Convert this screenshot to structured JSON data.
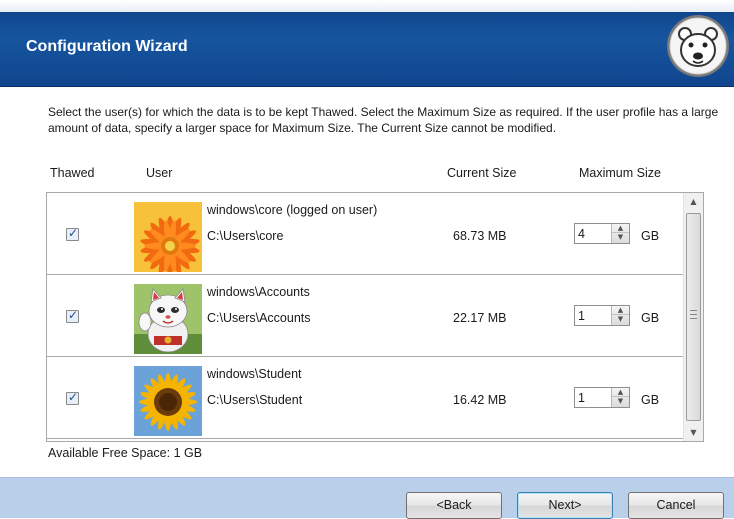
{
  "window": {
    "title": "Configuration Wizard"
  },
  "instruction": "Select the user(s) for which the data is to be kept Thawed. Select the Maximum Size as required. If the user profile has a large amount of data, specify a larger space for Maximum Size. The Current Size cannot be modified.",
  "columns": {
    "thawed": "Thawed",
    "user": "User",
    "current_size": "Current Size",
    "maximum_size": "Maximum Size"
  },
  "users": [
    {
      "name": "windows\\core (logged on user)",
      "path": "C:\\Users\\core",
      "current_size": "68.73 MB",
      "max_size": "4",
      "unit": "GB",
      "thawed": true,
      "image": "orange-gerbera-flower"
    },
    {
      "name": "windows\\Accounts",
      "path": "C:\\Users\\Accounts",
      "current_size": "22.17 MB",
      "max_size": "1",
      "unit": "GB",
      "thawed": true,
      "image": "lucky-cat-figurine"
    },
    {
      "name": "windows\\Student",
      "path": "C:\\Users\\Student",
      "current_size": "16.42 MB",
      "max_size": "1",
      "unit": "GB",
      "thawed": true,
      "image": "sunflower"
    }
  ],
  "free_space": {
    "label": "Available Free Space:",
    "value": "1 GB"
  },
  "buttons": {
    "back": "<Back",
    "next": "Next>",
    "cancel": "Cancel"
  },
  "icons": {
    "logo": "polar-bear-logo-icon",
    "spin_up": "arrow-up-icon",
    "spin_down": "arrow-down-icon",
    "scroll_up": "scroll-up-icon",
    "scroll_down": "scroll-down-icon"
  },
  "colors": {
    "title_bar": "#16559f",
    "footer": "#bad0ea",
    "default_button_border": "#3c7fb1"
  }
}
